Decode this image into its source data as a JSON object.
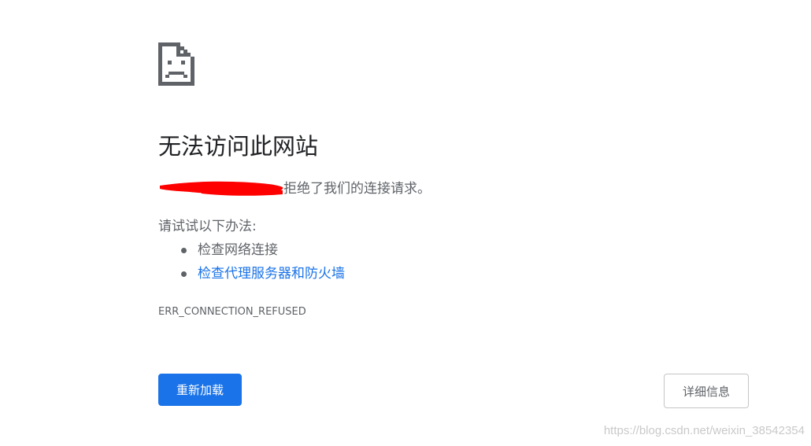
{
  "error_page": {
    "title": "无法访问此网站",
    "refused_message": "拒绝了我们的连接请求。",
    "try_heading": "请试试以下办法:",
    "suggestions": [
      {
        "label": "检查网络连接",
        "is_link": false
      },
      {
        "label": "检查代理服务器和防火墙",
        "is_link": true
      }
    ],
    "error_code": "ERR_CONNECTION_REFUSED",
    "reload_label": "重新加载",
    "details_label": "详细信息"
  },
  "watermark": "https://blog.csdn.net/weixin_38542354",
  "icons": {
    "page_icon": "sad-document-icon",
    "redaction": "red-scribble-redaction"
  },
  "colors": {
    "primary_button": "#1a73e8",
    "link": "#1a73e8",
    "text": "#5f6368",
    "title": "#202124",
    "redaction": "#ff0000"
  }
}
